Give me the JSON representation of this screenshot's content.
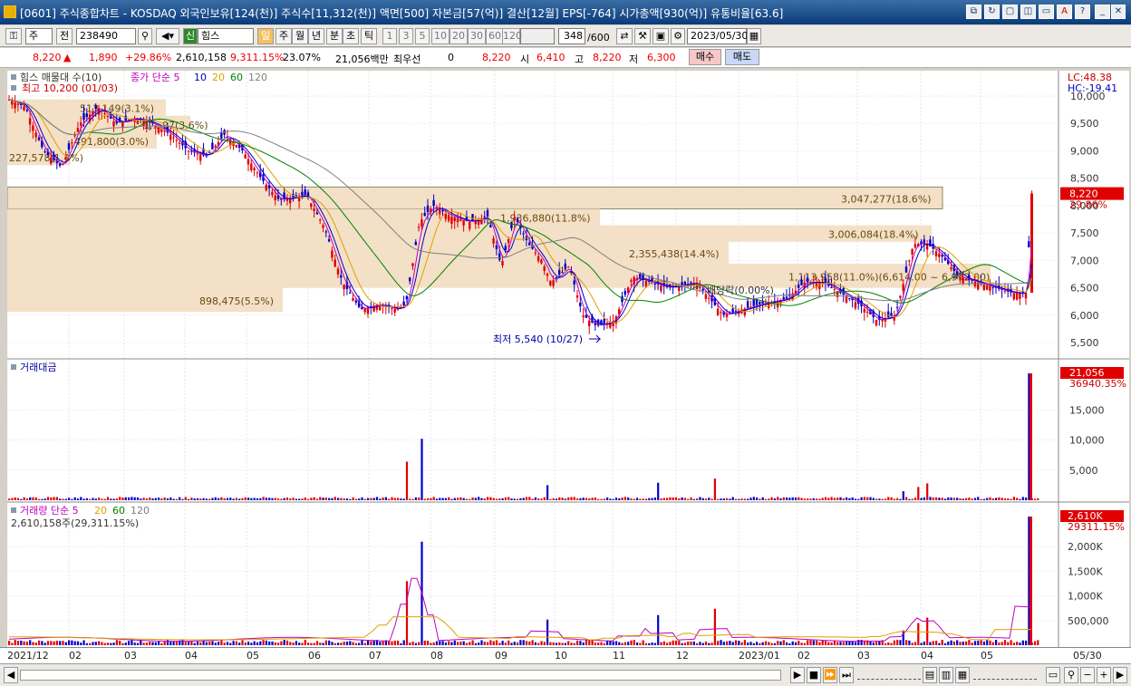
{
  "window": {
    "title": "[0601] 주식종합차트 - KOSDAQ 외국인보유[124(천)] 주식수[11,312(천)] 액면[500] 자본금[57(억)] 결산[12월] EPS[-764] 시가총액[930(억)] 유통비율[63.6]"
  },
  "toolbar": {
    "period_selector": "주",
    "mode_label": "전",
    "stock_code": "238490",
    "stock_tag": "신",
    "stock_name": "힘스",
    "interval_buttons": [
      "일",
      "주",
      "월",
      "년",
      "분",
      "초",
      "틱"
    ],
    "minute_buttons": [
      "1",
      "3",
      "5",
      "10",
      "20",
      "30",
      "60",
      "120"
    ],
    "bar_count": "348",
    "bar_total": "/600",
    "date": "2023/05/30"
  },
  "quote": {
    "price": "8,220",
    "change": "1,890",
    "change_pct": "+29.86%",
    "volume": "2,610,158",
    "volume_pct": "9,311.15%",
    "turnover": "23.07%",
    "amount": "21,056백만",
    "priority_label": "최우선",
    "priority_value": "0",
    "ask_price": "8,220",
    "open_label": "시",
    "open": "6,410",
    "high_label": "고",
    "high": "8,220",
    "low_label": "저",
    "low": "6,300",
    "buy_label": "매수",
    "sell_label": "매도"
  },
  "price_panel": {
    "legend_name": "힘스 매물대 수(10)",
    "legend_ma": "종가 단순 5",
    "ma_periods": [
      "10",
      "20",
      "60",
      "120"
    ],
    "high_note": "최고 10,200 (01/03)",
    "low_note": "최저 5,540 (10/27)",
    "lc": "LC:48.38",
    "hc": "HC:-19.41",
    "price_tag": "8,220",
    "pct_tag": "29.86%",
    "ticks": [
      "10,000",
      "9,500",
      "9,000",
      "8,500",
      "8,000",
      "7,500",
      "7,000",
      "6,500",
      "6,000",
      "5,500"
    ],
    "volume_profile": [
      {
        "label": "513,149(3.1%)"
      },
      {
        "label": "1,...97(3.6%)"
      },
      {
        "label": "491,800(3.0%)"
      },
      {
        "label": "227,578(1.4%)"
      },
      {
        "label": "3,047,277(18.6%)"
      },
      {
        "label": "1,936,880(11.8%)"
      },
      {
        "label": "3,006,084(18.4%)"
      },
      {
        "label": "2,355,438(14.4%)"
      },
      {
        "label": "1,113,958(11.0%)(6,614.00 ~ 6,992.00)"
      },
      {
        "label": "898,475(5.5%)"
      }
    ],
    "dividend_note": "배당락(0.00%)"
  },
  "amount_panel": {
    "legend": "거래대금",
    "tag": "21,056",
    "tag2": "36940.35%",
    "ticks": [
      "15,000",
      "10,000",
      "5,000"
    ]
  },
  "volume_panel": {
    "legend": "거래량 단순 5",
    "ma_periods": [
      "20",
      "60",
      "120"
    ],
    "info": "2,610,158주(29,311.15%)",
    "tag": "2,610K",
    "tag2": "29311.15%",
    "ticks": [
      "2,000K",
      "1,500K",
      "1,000K",
      "500,000"
    ]
  },
  "xaxis": {
    "labels": [
      "2021/12",
      "02",
      "03",
      "04",
      "05",
      "06",
      "07",
      "08",
      "09",
      "10",
      "11",
      "12",
      "2023/01",
      "02",
      "03",
      "04",
      "05"
    ],
    "right_label": "05/30"
  },
  "colors": {
    "up": "#e00000",
    "down": "#0000c8",
    "ma5": "#c000c0",
    "ma10": "#0000c8",
    "ma20": "#e0a000",
    "ma60": "#008000",
    "ma120": "#808080",
    "profile": "#f3e0c6"
  }
}
